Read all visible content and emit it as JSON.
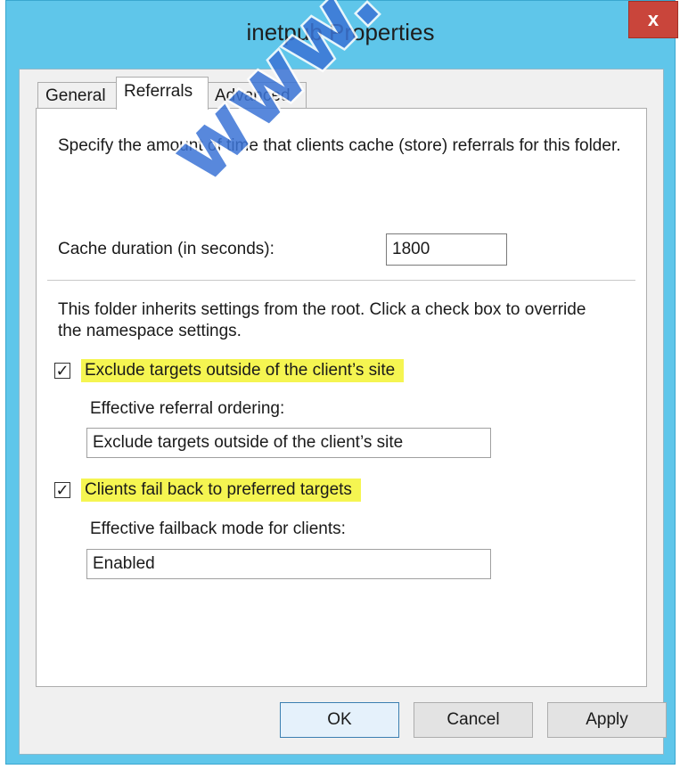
{
  "window": {
    "title": "inetpub Properties",
    "close_label": "x"
  },
  "tabs": [
    {
      "label": "General"
    },
    {
      "label": "Referrals"
    },
    {
      "label": "Advanced"
    }
  ],
  "referrals": {
    "description": "Specify the amount of time that clients cache (store) referrals for this folder.",
    "cache_label": "Cache duration (in seconds):",
    "cache_value": "1800",
    "inherit_text": "This folder inherits settings from the root. Click a check box to override the namespace settings.",
    "exclude_checkbox_label": "Exclude targets outside of the client’s site",
    "exclude_checked": true,
    "ordering_label": "Effective referral ordering:",
    "ordering_value": "Exclude targets outside of the client’s site",
    "failback_checkbox_label": "Clients fail back to preferred targets",
    "failback_checked": true,
    "failback_mode_label": "Effective failback mode for clients:",
    "failback_mode_value": "Enabled"
  },
  "buttons": {
    "ok": "OK",
    "cancel": "Cancel",
    "apply": "Apply"
  },
  "watermark": "www.Geek",
  "colors": {
    "titlebar": "#5fc6ea",
    "highlight": "#f5f551",
    "close": "#c9453b"
  }
}
